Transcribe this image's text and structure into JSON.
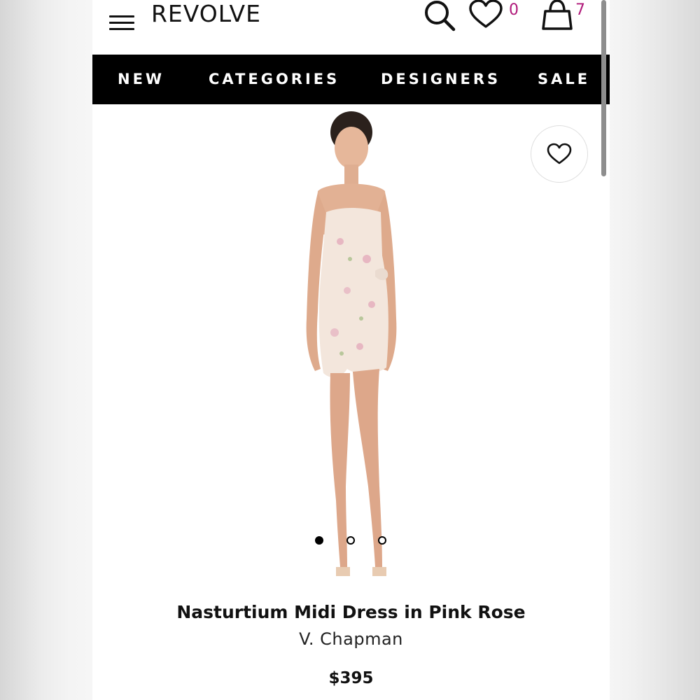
{
  "header": {
    "logo": "REVOLVE",
    "wishlist_count": "0",
    "bag_count": "7",
    "count_color": "#b0197a"
  },
  "nav": {
    "items": [
      "NEW",
      "CATEGORIES",
      "DESIGNERS",
      "SALE"
    ]
  },
  "product": {
    "name": "Nasturtium Midi Dress in Pink Rose",
    "brand": "V. Chapman",
    "price": "$395",
    "image_count": 3,
    "active_image": 1
  },
  "icons": {
    "menu": "hamburger-menu-icon",
    "search": "search-icon",
    "wishlist": "heart-icon",
    "bag": "shopping-bag-icon",
    "favorite": "heart-outline-icon"
  }
}
